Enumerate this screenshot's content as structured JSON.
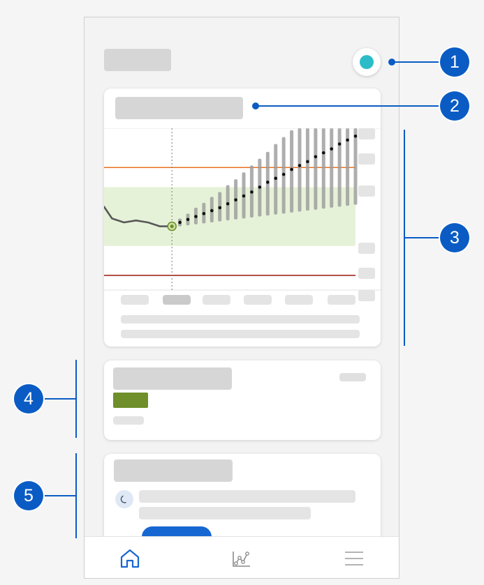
{
  "colors": {
    "accent": "#1767d2",
    "callout": "#0a5cc4",
    "avatar_dot": "#2cbcc8",
    "upper_limit_line": "#e8701f",
    "lower_limit_line": "#a2271c",
    "target_range": "#e6f2d8",
    "status_badge": "#6e8f2a"
  },
  "callouts": [
    "1",
    "2",
    "3",
    "4",
    "5"
  ],
  "icons": {
    "home": "home-icon",
    "trends": "trend-chart-icon",
    "menu": "hamburger-menu-icon",
    "night": "moon-icon"
  },
  "tabbar": {
    "active_tab": "home"
  },
  "chart_data": {
    "type": "line",
    "xlabel": "",
    "ylabel": "",
    "history": {
      "x": [
        0,
        2,
        5,
        8,
        11,
        14,
        17
      ],
      "y": [
        140,
        128,
        124,
        126,
        124,
        120,
        120
      ]
    },
    "forecast": {
      "x": [
        19,
        21,
        23,
        25,
        27,
        29,
        31,
        33,
        35,
        37,
        39,
        41,
        43,
        45,
        47,
        49,
        51,
        53,
        55,
        57,
        59,
        61,
        63
      ],
      "y": [
        124,
        127,
        130,
        133,
        136,
        139,
        143,
        147,
        151,
        155,
        160,
        165,
        169,
        173,
        178,
        182,
        186,
        191,
        195,
        199,
        204,
        208,
        212
      ],
      "low": [
        120,
        121,
        122,
        123,
        124,
        125,
        126,
        127,
        128,
        129,
        130,
        131,
        132,
        133,
        134,
        135,
        136,
        137,
        138,
        139,
        140,
        141,
        142
      ],
      "high": [
        128,
        133,
        139,
        144,
        150,
        155,
        162,
        168,
        175,
        182,
        189,
        196,
        204,
        211,
        218,
        225,
        232,
        239,
        246,
        253,
        258,
        258,
        258
      ]
    },
    "now_x": 17,
    "upper_limit": 180,
    "lower_limit": 70,
    "target_range": [
      100,
      160
    ],
    "xlim": [
      0,
      63
    ],
    "ylim": [
      55,
      220
    ],
    "grid": false,
    "legend": "none"
  }
}
